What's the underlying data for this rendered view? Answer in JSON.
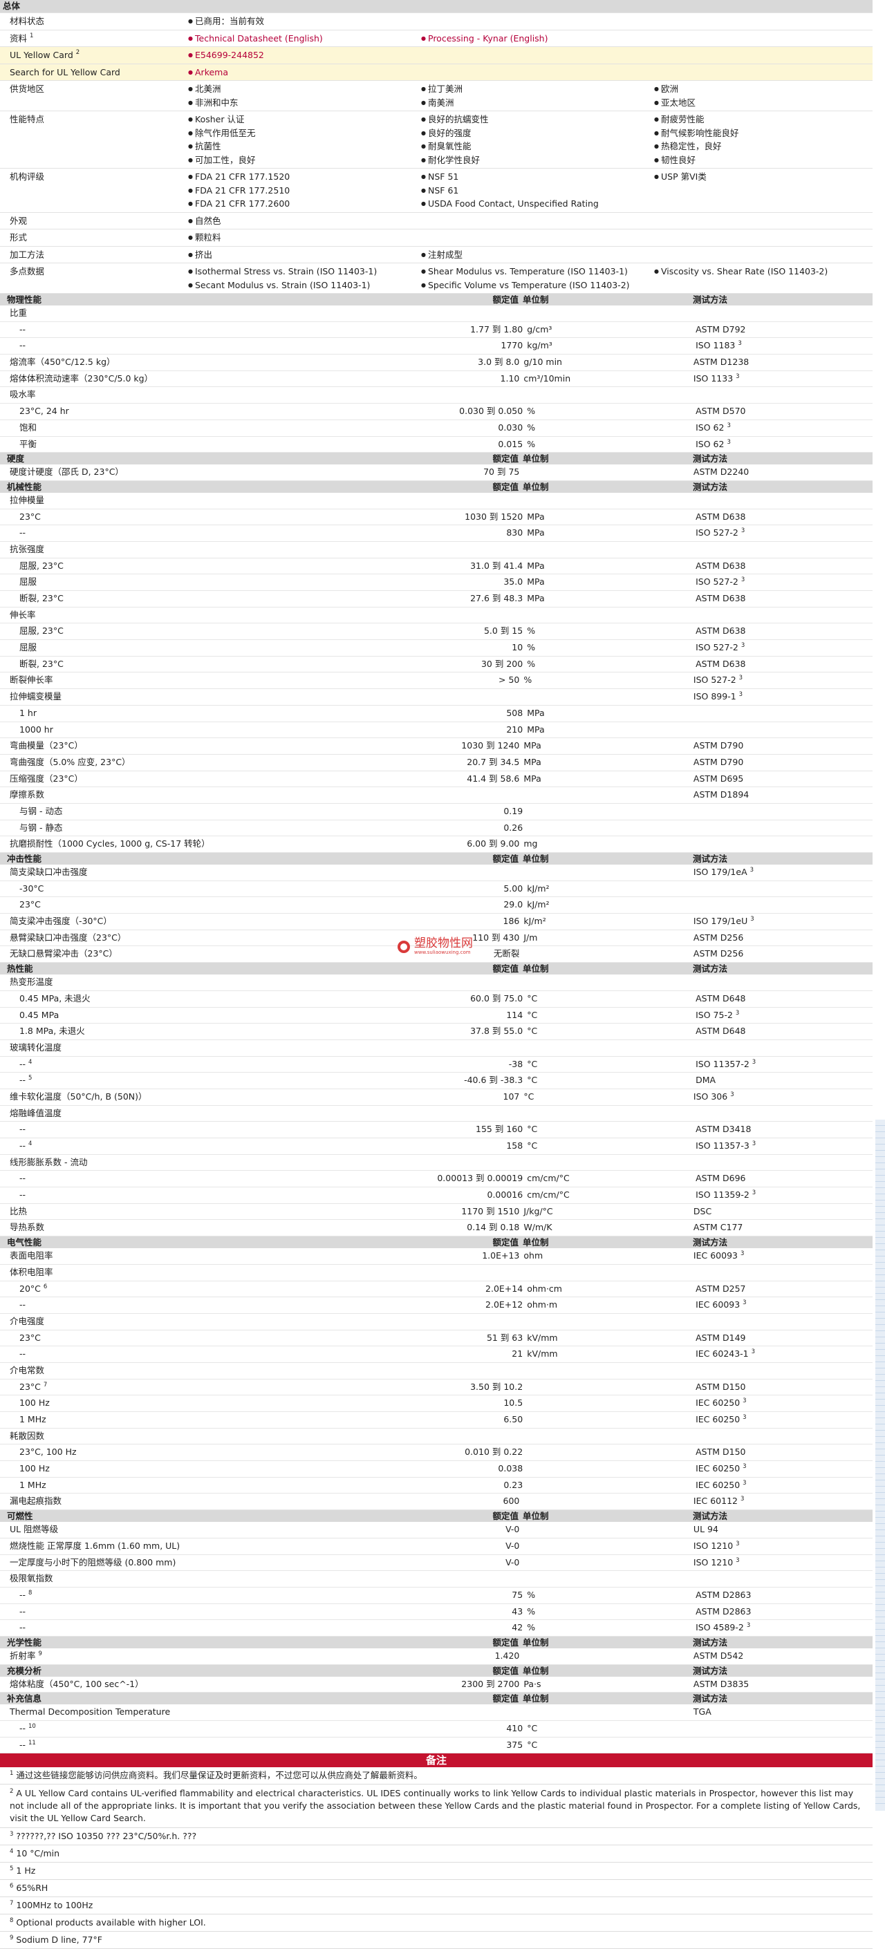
{
  "general": {
    "header": "总体",
    "rows": [
      {
        "label": "材料状态",
        "values": [
          "已商用：当前有效"
        ]
      },
      {
        "label": "资料",
        "label_sup": "1",
        "values": [
          "Technical Datasheet (English)",
          "Processing - Kynar (English)"
        ],
        "links": true
      },
      {
        "label": "UL Yellow Card",
        "label_sup": "2",
        "values": [
          "E54699-244852"
        ],
        "links": true,
        "highlight": true
      },
      {
        "label": "Search for UL Yellow Card",
        "values": [
          "Arkema"
        ],
        "links": true,
        "highlight": true
      },
      {
        "label": "供货地区",
        "values": [
          "北美洲",
          "拉丁美洲",
          "欧洲",
          "非洲和中东",
          "南美洲",
          "亚太地区"
        ]
      },
      {
        "label": "性能特点",
        "values": [
          "Kosher 认证",
          "良好的抗蠕变性",
          "耐疲劳性能",
          "除气作用低至无",
          "良好的强度",
          "耐气候影响性能良好",
          "抗菌性",
          "耐臭氧性能",
          "热稳定性，良好",
          "可加工性，良好",
          "耐化学性良好",
          "韧性良好"
        ]
      },
      {
        "label": "机构评级",
        "values": [
          "FDA 21 CFR 177.1520",
          "NSF 51",
          "USP 第VI类",
          "FDA 21 CFR 177.2510",
          "NSF 61",
          "",
          "FDA 21 CFR 177.2600",
          "USDA Food Contact, Unspecified Rating",
          ""
        ]
      },
      {
        "label": "外观",
        "values": [
          "自然色"
        ]
      },
      {
        "label": "形式",
        "values": [
          "颗粒料"
        ]
      },
      {
        "label": "加工方法",
        "values": [
          "挤出",
          "注射成型"
        ]
      },
      {
        "label": "多点数据",
        "values": [
          "Isothermal Stress vs. Strain (ISO 11403-1)",
          "Shear Modulus vs. Temperature (ISO 11403-1)",
          "Viscosity vs. Shear Rate (ISO 11403-2)",
          "Secant Modulus vs. Strain (ISO 11403-1)",
          "Specific Volume vs Temperature (ISO 11403-2)",
          ""
        ]
      }
    ]
  },
  "properties": [
    {
      "t": "h",
      "name": "物理性能",
      "val": "额定值",
      "unit": "单位制",
      "method": "测试方法"
    },
    {
      "t": "p",
      "name": "比重"
    },
    {
      "t": "s",
      "name": "--",
      "val": "1.77 到  1.80",
      "unit": "g/cm³",
      "method": "ASTM D792"
    },
    {
      "t": "s",
      "name": "--",
      "val": "1770",
      "unit": "kg/m³",
      "method": "ISO 1183",
      "msup": "3"
    },
    {
      "t": "p",
      "name": "熔流率（450°C/12.5 kg）",
      "val": "3.0 到  8.0",
      "unit": "g/10 min",
      "method": "ASTM D1238"
    },
    {
      "t": "p",
      "name": "熔体体积流动速率（230°C/5.0 kg）",
      "val": "1.10",
      "unit": "cm³/10min",
      "method": "ISO 1133",
      "msup": "3"
    },
    {
      "t": "p",
      "name": "吸水率"
    },
    {
      "t": "s",
      "name": "23°C, 24 hr",
      "val": "0.030 到  0.050",
      "unit": "%",
      "method": "ASTM D570"
    },
    {
      "t": "s",
      "name": "饱和",
      "val": "0.030",
      "unit": "%",
      "method": "ISO 62",
      "msup": "3"
    },
    {
      "t": "s",
      "name": "平衡",
      "val": "0.015",
      "unit": "%",
      "method": "ISO 62",
      "msup": "3"
    },
    {
      "t": "h",
      "name": "硬度",
      "val": "额定值",
      "unit": "单位制",
      "method": "测试方法"
    },
    {
      "t": "p",
      "name": "硬度计硬度（邵氏 D, 23°C）",
      "val": "70 到  75",
      "unit": "",
      "method": "ASTM D2240"
    },
    {
      "t": "h",
      "name": "机械性能",
      "val": "额定值",
      "unit": "单位制",
      "method": "测试方法"
    },
    {
      "t": "p",
      "name": "拉伸模量"
    },
    {
      "t": "s",
      "name": "23°C",
      "val": "1030 到  1520",
      "unit": "MPa",
      "method": "ASTM D638"
    },
    {
      "t": "s",
      "name": "--",
      "val": "830",
      "unit": "MPa",
      "method": "ISO 527-2",
      "msup": "3"
    },
    {
      "t": "p",
      "name": "抗张强度"
    },
    {
      "t": "s",
      "name": "屈服, 23°C",
      "val": "31.0 到  41.4",
      "unit": "MPa",
      "method": "ASTM D638"
    },
    {
      "t": "s",
      "name": "屈服",
      "val": "35.0",
      "unit": "MPa",
      "method": "ISO 527-2",
      "msup": "3"
    },
    {
      "t": "s",
      "name": "断裂, 23°C",
      "val": "27.6 到  48.3",
      "unit": "MPa",
      "method": "ASTM D638"
    },
    {
      "t": "p",
      "name": "伸长率"
    },
    {
      "t": "s",
      "name": "屈服, 23°C",
      "val": "5.0 到  15",
      "unit": "%",
      "method": "ASTM D638"
    },
    {
      "t": "s",
      "name": "屈服",
      "val": "10",
      "unit": "%",
      "method": "ISO 527-2",
      "msup": "3"
    },
    {
      "t": "s",
      "name": "断裂, 23°C",
      "val": "30 到  200",
      "unit": "%",
      "method": "ASTM D638"
    },
    {
      "t": "p",
      "name": "断裂伸长率",
      "val": "> 50",
      "unit": "%",
      "method": "ISO 527-2",
      "msup": "3"
    },
    {
      "t": "p",
      "name": "拉伸蠕变模量",
      "val": "",
      "unit": "",
      "method": "ISO 899-1",
      "msup": "3"
    },
    {
      "t": "s",
      "name": "1 hr",
      "val": "508",
      "unit": "MPa",
      "method": ""
    },
    {
      "t": "s",
      "name": "1000 hr",
      "val": "210",
      "unit": "MPa",
      "method": ""
    },
    {
      "t": "p",
      "name": "弯曲模量（23°C）",
      "val": "1030 到  1240",
      "unit": "MPa",
      "method": "ASTM D790"
    },
    {
      "t": "p",
      "name": "弯曲强度（5.0% 应变, 23°C）",
      "val": "20.7 到  34.5",
      "unit": "MPa",
      "method": "ASTM D790"
    },
    {
      "t": "p",
      "name": "压缩强度（23°C）",
      "val": "41.4 到  58.6",
      "unit": "MPa",
      "method": "ASTM D695"
    },
    {
      "t": "p",
      "name": "摩擦系数",
      "val": "",
      "unit": "",
      "method": "ASTM D1894"
    },
    {
      "t": "s",
      "name": "与钢 - 动态",
      "val": "0.19",
      "unit": "",
      "method": ""
    },
    {
      "t": "s",
      "name": "与钢 - 静态",
      "val": "0.26",
      "unit": "",
      "method": ""
    },
    {
      "t": "p",
      "name": "抗磨损耐性（1000 Cycles, 1000 g, CS-17 转轮）",
      "val": "6.00 到  9.00",
      "unit": "mg",
      "method": ""
    },
    {
      "t": "h",
      "name": "冲击性能",
      "val": "额定值",
      "unit": "单位制",
      "method": "测试方法"
    },
    {
      "t": "p",
      "name": "简支梁缺口冲击强度",
      "val": "",
      "unit": "",
      "method": "ISO 179/1eA",
      "msup": "3"
    },
    {
      "t": "s",
      "name": "-30°C",
      "val": "5.00",
      "unit": "kJ/m²",
      "method": ""
    },
    {
      "t": "s",
      "name": "23°C",
      "val": "29.0",
      "unit": "kJ/m²",
      "method": ""
    },
    {
      "t": "p",
      "name": "简支梁冲击强度（-30°C）",
      "val": "186",
      "unit": "kJ/m²",
      "method": "ISO 179/1eU",
      "msup": "3"
    },
    {
      "t": "p",
      "name": "悬臂梁缺口冲击强度（23°C）",
      "val": "110 到  430",
      "unit": "J/m",
      "method": "ASTM D256"
    },
    {
      "t": "p",
      "name": "无缺口悬臂梁冲击（23°C）",
      "val": "无断裂",
      "unit": "",
      "method": "ASTM D256"
    },
    {
      "t": "h",
      "name": "热性能",
      "val": "额定值",
      "unit": "单位制",
      "method": "测试方法"
    },
    {
      "t": "p",
      "name": "热变形温度"
    },
    {
      "t": "s",
      "name": "0.45 MPa, 未退火",
      "val": "60.0 到  75.0",
      "unit": "°C",
      "method": "ASTM D648"
    },
    {
      "t": "s",
      "name": "0.45 MPa",
      "val": "114",
      "unit": "°C",
      "method": "ISO 75-2",
      "msup": "3"
    },
    {
      "t": "s",
      "name": "1.8 MPa, 未退火",
      "val": "37.8 到  55.0",
      "unit": "°C",
      "method": "ASTM D648"
    },
    {
      "t": "p",
      "name": "玻璃转化温度"
    },
    {
      "t": "s",
      "name": "--",
      "nsup": "4",
      "val": "-38",
      "unit": "°C",
      "method": "ISO 11357-2",
      "msup": "3"
    },
    {
      "t": "s",
      "name": "--",
      "nsup": "5",
      "val": "-40.6 到  -38.3",
      "unit": "°C",
      "method": "DMA"
    },
    {
      "t": "p",
      "name": "维卡软化温度（50°C/h, B (50N)）",
      "val": "107",
      "unit": "°C",
      "method": "ISO 306",
      "msup": "3"
    },
    {
      "t": "p",
      "name": "熔融峰值温度"
    },
    {
      "t": "s",
      "name": "--",
      "val": "155 到  160",
      "unit": "°C",
      "method": "ASTM D3418"
    },
    {
      "t": "s",
      "name": "--",
      "nsup": "4",
      "val": "158",
      "unit": "°C",
      "method": "ISO 11357-3",
      "msup": "3"
    },
    {
      "t": "p",
      "name": "线形膨胀系数 - 流动"
    },
    {
      "t": "s",
      "name": "--",
      "val": "0.00013 到  0.00019",
      "unit": "cm/cm/°C",
      "method": "ASTM D696"
    },
    {
      "t": "s",
      "name": "--",
      "val": "0.00016",
      "unit": "cm/cm/°C",
      "method": "ISO 11359-2",
      "msup": "3"
    },
    {
      "t": "p",
      "name": "比热",
      "val": "1170 到  1510",
      "unit": "J/kg/°C",
      "method": "DSC"
    },
    {
      "t": "p",
      "name": "导热系数",
      "val": "0.14 到  0.18",
      "unit": "W/m/K",
      "method": "ASTM C177"
    },
    {
      "t": "h",
      "name": "电气性能",
      "val": "额定值",
      "unit": "单位制",
      "method": "测试方法"
    },
    {
      "t": "p",
      "name": "表面电阻率",
      "val": "1.0E+13",
      "unit": "ohm",
      "method": "IEC 60093",
      "msup": "3"
    },
    {
      "t": "p",
      "name": "体积电阻率"
    },
    {
      "t": "s",
      "name": "20°C",
      "nsup": "6",
      "val": "2.0E+14",
      "unit": "ohm·cm",
      "method": "ASTM D257"
    },
    {
      "t": "s",
      "name": "--",
      "val": "2.0E+12",
      "unit": "ohm·m",
      "method": "IEC 60093",
      "msup": "3"
    },
    {
      "t": "p",
      "name": "介电强度"
    },
    {
      "t": "s",
      "name": "23°C",
      "val": "51 到  63",
      "unit": "kV/mm",
      "method": "ASTM D149"
    },
    {
      "t": "s",
      "name": "--",
      "val": "21",
      "unit": "kV/mm",
      "method": "IEC 60243-1",
      "msup": "3"
    },
    {
      "t": "p",
      "name": "介电常数"
    },
    {
      "t": "s",
      "name": "23°C",
      "nsup": "7",
      "val": "3.50 到  10.2",
      "unit": "",
      "method": "ASTM D150"
    },
    {
      "t": "s",
      "name": "100 Hz",
      "val": "10.5",
      "unit": "",
      "method": "IEC 60250",
      "msup": "3"
    },
    {
      "t": "s",
      "name": "1 MHz",
      "val": "6.50",
      "unit": "",
      "method": "IEC 60250",
      "msup": "3"
    },
    {
      "t": "p",
      "name": "耗散因数"
    },
    {
      "t": "s",
      "name": "23°C, 100 Hz",
      "val": "0.010 到  0.22",
      "unit": "",
      "method": "ASTM D150"
    },
    {
      "t": "s",
      "name": "100 Hz",
      "val": "0.038",
      "unit": "",
      "method": "IEC 60250",
      "msup": "3"
    },
    {
      "t": "s",
      "name": "1 MHz",
      "val": "0.23",
      "unit": "",
      "method": "IEC 60250",
      "msup": "3"
    },
    {
      "t": "p",
      "name": "漏电起痕指数",
      "val": "600",
      "unit": "",
      "method": "IEC 60112",
      "msup": "3"
    },
    {
      "t": "h",
      "name": "可燃性",
      "val": "额定值",
      "unit": "单位制",
      "method": "测试方法"
    },
    {
      "t": "p",
      "name": "UL 阻燃等级",
      "val": "V-0",
      "unit": "",
      "method": "UL 94"
    },
    {
      "t": "p",
      "name": "燃烧性能 正常厚度 1.6mm (1.60 mm, UL)",
      "val": "V-0",
      "unit": "",
      "method": "ISO 1210",
      "msup": "3"
    },
    {
      "t": "p",
      "name": "一定厚度与小时下的阻燃等级 (0.800 mm)",
      "val": "V-0",
      "unit": "",
      "method": "ISO 1210",
      "msup": "3"
    },
    {
      "t": "p",
      "name": "极限氧指数"
    },
    {
      "t": "s",
      "name": "--",
      "nsup": "8",
      "val": "75",
      "unit": "%",
      "method": "ASTM D2863"
    },
    {
      "t": "s",
      "name": "--",
      "val": "43",
      "unit": "%",
      "method": "ASTM D2863"
    },
    {
      "t": "s",
      "name": "--",
      "val": "42",
      "unit": "%",
      "method": "ISO 4589-2",
      "msup": "3"
    },
    {
      "t": "h",
      "name": "光学性能",
      "val": "额定值",
      "unit": "单位制",
      "method": "测试方法"
    },
    {
      "t": "p",
      "name": "折射率",
      "nsup": "9",
      "val": "1.420",
      "unit": "",
      "method": "ASTM D542"
    },
    {
      "t": "h",
      "name": "充模分析",
      "val": "额定值",
      "unit": "单位制",
      "method": "测试方法"
    },
    {
      "t": "p",
      "name": "熔体粘度（450°C, 100 sec^-1）",
      "val": "2300 到  2700",
      "unit": "Pa·s",
      "method": "ASTM D3835"
    },
    {
      "t": "h",
      "name": "补充信息",
      "val": "额定值",
      "unit": "单位制",
      "method": "测试方法"
    },
    {
      "t": "p",
      "name": "Thermal Decomposition Temperature",
      "val": "",
      "unit": "",
      "method": "TGA"
    },
    {
      "t": "s",
      "name": "--",
      "nsup": "10",
      "val": "410",
      "unit": "°C",
      "method": ""
    },
    {
      "t": "s",
      "name": "--",
      "nsup": "11",
      "val": "375",
      "unit": "°C",
      "method": ""
    }
  ],
  "notes": {
    "title": "备注",
    "items": [
      {
        "n": "1",
        "text": "通过这些链接您能够访问供应商资料。我们尽量保证及时更新资料，不过您可以从供应商处了解最新资料。"
      },
      {
        "n": "2",
        "text": "A UL Yellow Card contains UL-verified flammability and electrical characteristics. UL IDES continually works to link Yellow Cards to individual plastic materials in Prospector, however this list may not include all of the appropriate links. It is important that you verify the association between these Yellow Cards and the plastic material found in Prospector. For a complete listing of Yellow Cards, visit the UL Yellow Card Search."
      },
      {
        "n": "3",
        "text": "??????,?? ISO 10350 ??? 23°C/50%r.h. ???"
      },
      {
        "n": "4",
        "text": "10 °C/min"
      },
      {
        "n": "5",
        "text": "1 Hz"
      },
      {
        "n": "6",
        "text": "65%RH"
      },
      {
        "n": "7",
        "text": "100MHz to 100Hz"
      },
      {
        "n": "8",
        "text": "Optional products available with higher LOI."
      },
      {
        "n": "9",
        "text": "Sodium D line, 77°F"
      }
    ]
  },
  "watermark": {
    "main": "塑胶物性网",
    "sub": "www.suliaowuxing.com"
  }
}
